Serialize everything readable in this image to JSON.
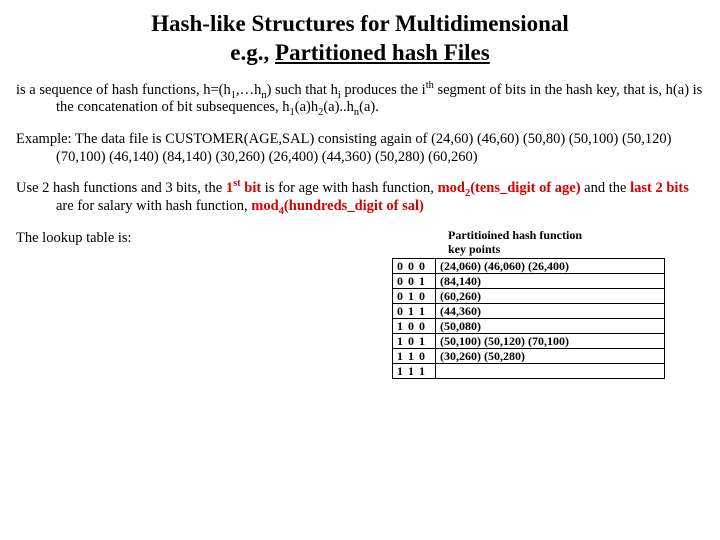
{
  "title": {
    "line1": "Hash-like Structures for Multidimensional",
    "line2_plain": "e.g., ",
    "line2_under": "Partitioned hash Files"
  },
  "para1": {
    "pre": "is a sequence of hash functions, h=(h",
    "s1": "1",
    "mid1": ",…h",
    "s2": "n",
    "mid2": ") such that h",
    "s3": "i",
    "mid3": " produces the i",
    "sup1": "th",
    "mid4": " segment of bits in the hash key, that is, h(a) is the concatenation of bit subsequences, h",
    "s4": "1",
    "mid5": "(a)h",
    "s5": "2",
    "mid6": "(a)..h",
    "s6": "n",
    "mid7": "(a)."
  },
  "para2": "Example: The data file is CUSTOMER(AGE,SAL) consisting again of (24,60) (46,60) (50,80) (50,100) (50,120) (70,100) (46,140) (84,140) (30,260) (26,400) (44,360) (50,280) (60,260)",
  "para3": {
    "pre": "Use 2 hash functions and 3 bits, the ",
    "red1_pre": "1",
    "red1_sup": "st",
    "red1_post": " bit",
    "mid1": " is for age with hash function, ",
    "red2_pre": "mod",
    "red2_sub": "2",
    "red2_post": "(tens_digit of age)",
    "mid2": " and the ",
    "red3": "last 2 bits",
    "mid3": " are for salary with hash function, ",
    "red4_pre": "mod",
    "red4_sub": "4",
    "red4_post": "(hundreds_digit of sal)"
  },
  "para4": "The lookup table is:",
  "legend": {
    "line1": "Partitioined  hash function",
    "line2": "key   points"
  },
  "table": {
    "rows": [
      {
        "key": "0 0 0",
        "points": "(24,060)  (46,060)  (26,400)"
      },
      {
        "key": "0 0 1",
        "points": "(84,140)"
      },
      {
        "key": "0 1 0",
        "points": "(60,260)"
      },
      {
        "key": "0 1 1",
        "points": "(44,360)"
      },
      {
        "key": "1 0 0",
        "points": "(50,080)"
      },
      {
        "key": "1 0 1",
        "points": "(50,100) (50,120)  (70,100)"
      },
      {
        "key": "1 1 0",
        "points": "(30,260) (50,280)"
      },
      {
        "key": "1 1 1",
        "points": ""
      }
    ]
  }
}
